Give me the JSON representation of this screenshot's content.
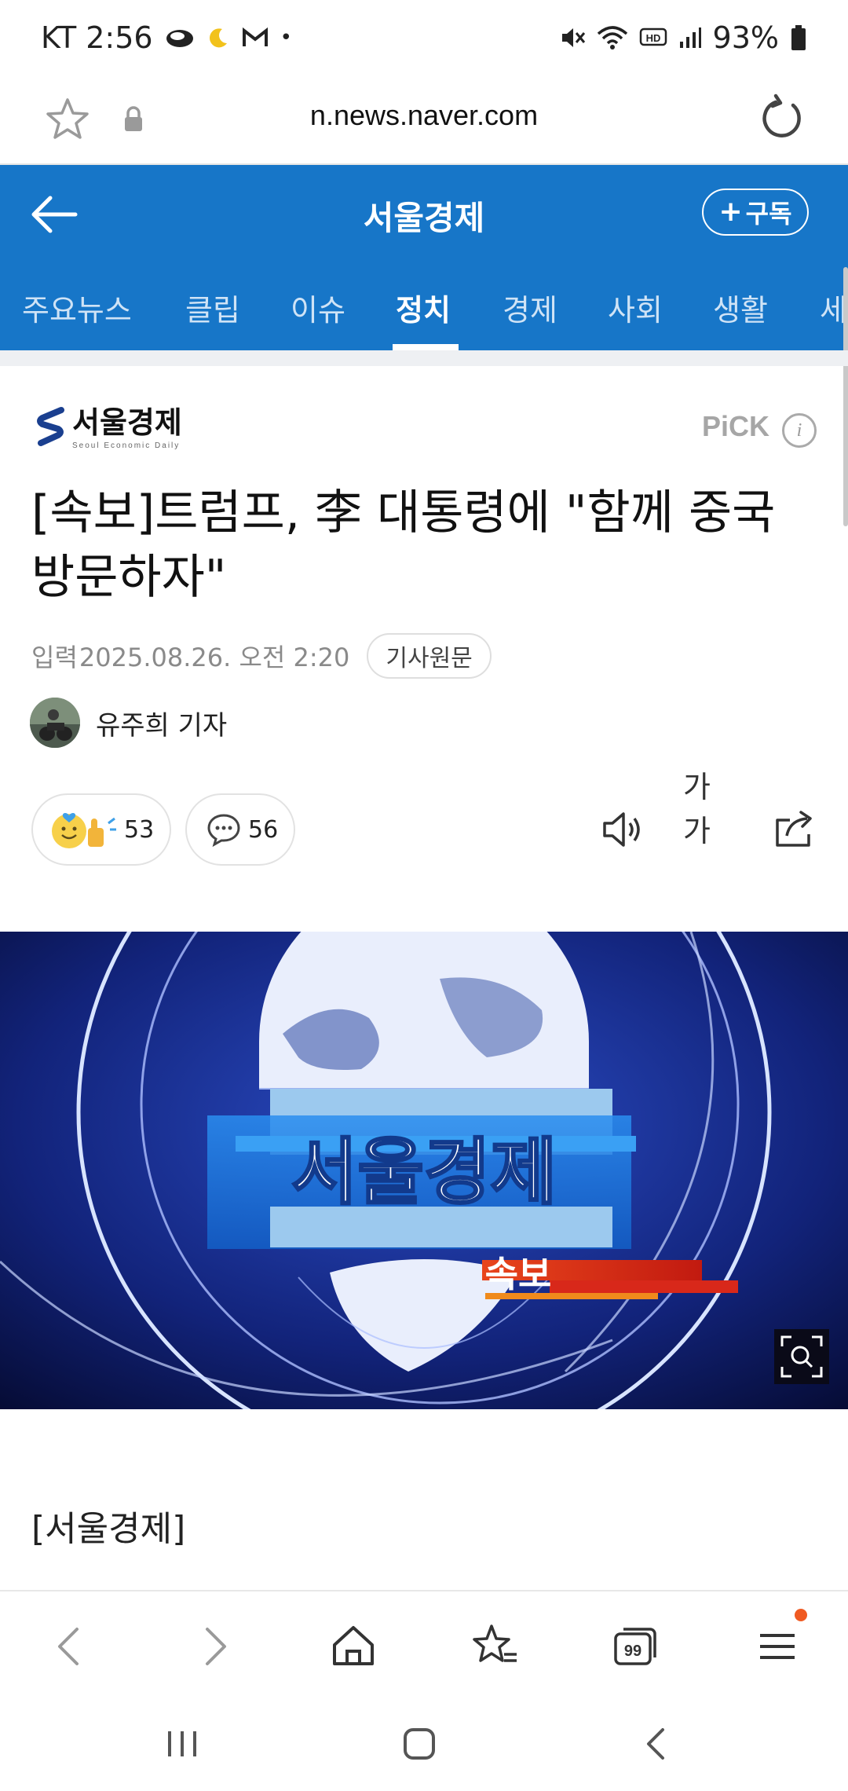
{
  "status_bar": {
    "carrier_time": "KT 2:56",
    "dot": "•",
    "battery": "93%",
    "icons": [
      "cloud-icon",
      "moon-icon",
      "gmail-icon",
      "mute-icon",
      "wifi-icon",
      "hd-icon",
      "signal-icon",
      "battery-icon"
    ]
  },
  "url_bar": {
    "url": "n.news.naver.com",
    "icons": [
      "star-icon",
      "lock-icon",
      "reload-icon"
    ]
  },
  "press_header": {
    "title": "서울경제",
    "subscribe_label": "구독"
  },
  "categories": {
    "items": [
      "주요뉴스",
      "클립",
      "이슈",
      "정치",
      "경제",
      "사회",
      "생활",
      "세"
    ],
    "active": "정치"
  },
  "article": {
    "press_name": "서울경제",
    "press_sub": "Seoul Economic Daily",
    "pick_label": "PiCK",
    "info_glyph": "i",
    "headline": "[속보]트럼프, 李 대통령에 \"함께 중국 방문하자\"",
    "meta_label": "입력",
    "meta_date": "2025.08.26. 오전 2:20",
    "original_button": "기사원문",
    "reporter": "유주희 기자",
    "reactions_count": "53",
    "comments_count": "56",
    "font_tool_label": "가가",
    "body_start": "[서울경제]"
  },
  "hero_image": {
    "logo_text": "서울경제",
    "tag_text": "속보"
  },
  "colors": {
    "header_blue": "#1776c8",
    "accent_orange": "#f05a22"
  }
}
